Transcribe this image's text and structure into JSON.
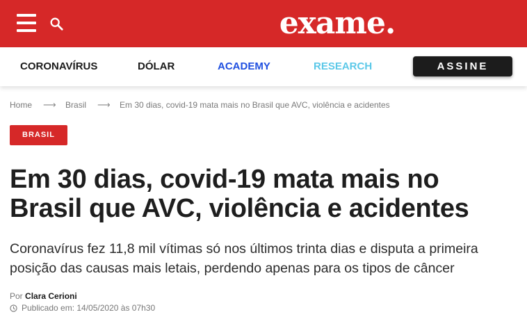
{
  "header": {
    "logo_text": "exame.",
    "brand_color": "#d62828",
    "menu_icon": "hamburger-menu-icon",
    "search_icon": "search-icon"
  },
  "nav": {
    "items": [
      {
        "label": "CORONAVÍRUS",
        "color": "#1a1a1a"
      },
      {
        "label": "DÓLAR",
        "color": "#1a1a1a"
      },
      {
        "label": "ACADEMY",
        "color": "#1f4fe0"
      },
      {
        "label": "RESEARCH",
        "color": "#5bc8e8"
      }
    ],
    "subscribe_label": "ASSINE"
  },
  "breadcrumb": {
    "items": [
      "Home",
      "Brasil",
      "Em 30 dias, covid-19 mata mais no Brasil que AVC, violência e acidentes"
    ],
    "separator_icon": "arrow-right-icon"
  },
  "article": {
    "category": "BRASIL",
    "headline": "Em 30 dias, covid-19 mata mais no Brasil que AVC, violência e acidentes",
    "subtitle": "Coronavírus fez 11,8 mil vítimas só nos últimos trinta dias e disputa a primeira posição das causas mais letais, perdendo apenas para os tipos de câncer",
    "byline_prefix": "Por",
    "author": "Clara Cerioni",
    "published": "Publicado em: 14/05/2020 às 07h30"
  }
}
